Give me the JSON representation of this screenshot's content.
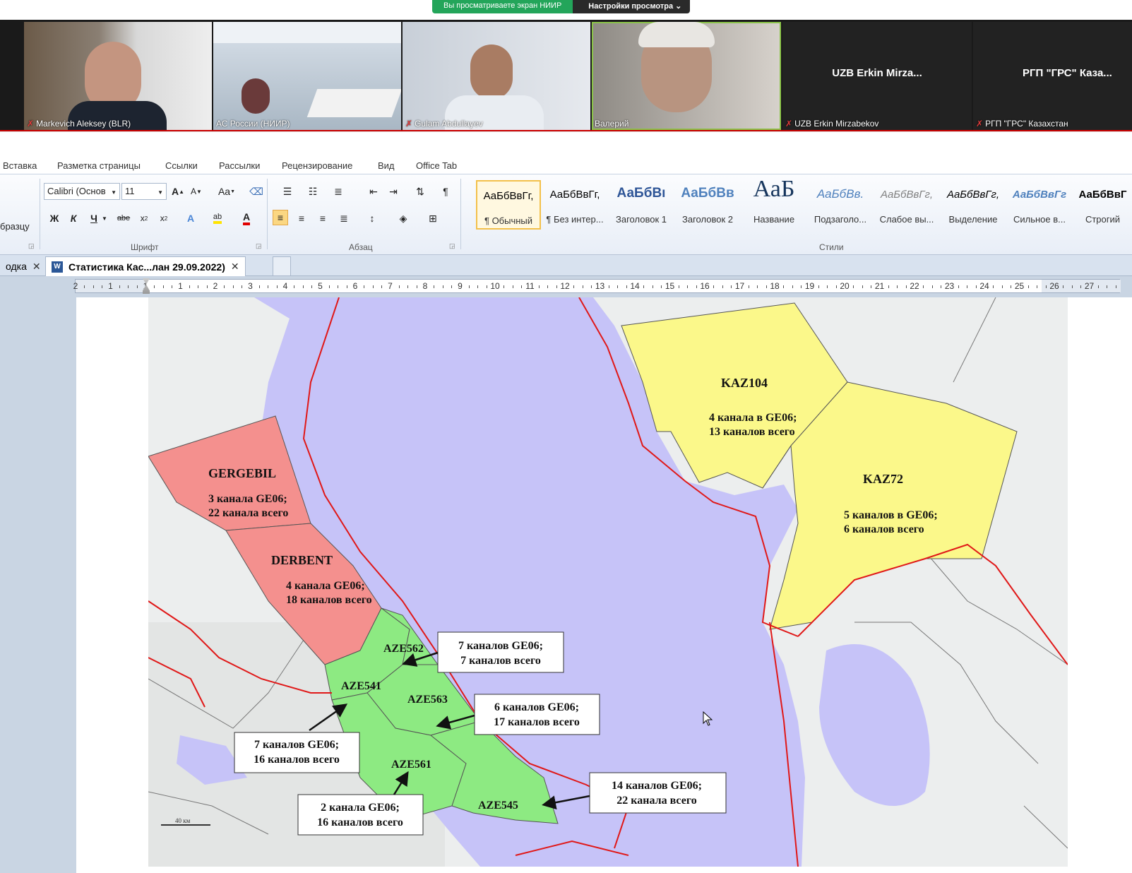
{
  "zoom": {
    "share_text": "Вы просматриваете экран НИИР",
    "view_settings": "Настройки просмотра ⌄"
  },
  "participants": [
    {
      "name": "Markevich Aleksey (BLR)",
      "muted": true
    },
    {
      "name": "АС России (НИИР)",
      "muted": false
    },
    {
      "name": "Gulam Abdullayev",
      "muted": true
    },
    {
      "name": "Валерий",
      "muted": false
    },
    {
      "name": "UZB Erkin Mirzabekov",
      "muted": true,
      "display": "UZB  Erkin  Mirza..."
    },
    {
      "name": "РГП \"ГРС\" Казахстан",
      "muted": true,
      "display": "РГП  \"ГРС\"  Каза..."
    }
  ],
  "ribbon_tabs": [
    "Вставка",
    "Разметка страницы",
    "Ссылки",
    "Рассылки",
    "Рецензирование",
    "Вид",
    "Office Tab"
  ],
  "ribbon": {
    "clipboard_partial": "бразцу",
    "font_name": "Calibri (Основ",
    "font_size": "11",
    "group_font": "Шрифт",
    "group_paragraph": "Абзац",
    "group_styles": "Стили",
    "styles": [
      {
        "sample": "АаБбВвГг,",
        "label": "¶ Обычный",
        "selected": true
      },
      {
        "sample": "АаБбВвГг,",
        "label": "¶ Без интер..."
      },
      {
        "sample": "АаБбВı",
        "label": "Заголовок 1"
      },
      {
        "sample": "АаБбВв",
        "label": "Заголовок 2"
      },
      {
        "sample": "АаБ",
        "label": "Название"
      },
      {
        "sample": "АаБбВв.",
        "label": "Подзаголо..."
      },
      {
        "sample": "АаБбВвГг,",
        "label": "Слабое вы..."
      },
      {
        "sample": "АаБбВвГг,",
        "label": "Выделение"
      },
      {
        "sample": "АаБбВвГг",
        "label": "Сильное в..."
      },
      {
        "sample": "АаБбВвГ",
        "label": "Строгий"
      }
    ]
  },
  "doc_tabs": {
    "partial": "одка",
    "active": "Статистика Кас...лан 29.09.2022)"
  },
  "ruler_numbers": [
    "2",
    "1",
    "1",
    "1",
    "2",
    "3",
    "4",
    "5",
    "6",
    "7",
    "8",
    "9",
    "10",
    "11",
    "12",
    "13",
    "14",
    "15",
    "16",
    "17",
    "18",
    "19",
    "20",
    "21",
    "22",
    "23",
    "24",
    "25",
    "26",
    "27"
  ],
  "map": {
    "regions": {
      "gergebil": {
        "name": "GERGEBIL",
        "l1": "3 канала GE06;",
        "l2": "22 канала всего"
      },
      "derbent": {
        "name": "DERBENT",
        "l1": "4 канала GE06;",
        "l2": "18 каналов всего"
      },
      "kaz104": {
        "name": "KAZ104",
        "l1": "4 канала в GE06;",
        "l2": "13 каналов всего"
      },
      "kaz72": {
        "name": "KAZ72",
        "l1": "5 каналов в GE06;",
        "l2": "6 каналов всего"
      },
      "aze562": {
        "name": "AZE562"
      },
      "aze541": {
        "name": "AZE541"
      },
      "aze563": {
        "name": "AZE563"
      },
      "aze561": {
        "name": "AZE561"
      },
      "aze545": {
        "name": "AZE545"
      }
    },
    "callouts": {
      "c562": {
        "l1": "7 каналов GE06;",
        "l2": "7 каналов всего"
      },
      "c563": {
        "l1": "6 каналов GE06;",
        "l2": "17 каналов всего"
      },
      "c541": {
        "l1": "7 каналов GE06;",
        "l2": "16 каналов всего"
      },
      "c561": {
        "l1": "2 канала GE06;",
        "l2": "16 каналов всего"
      },
      "c545": {
        "l1": "14 каналов GE06;",
        "l2": "22 канала всего"
      }
    },
    "scale": "40 км"
  }
}
